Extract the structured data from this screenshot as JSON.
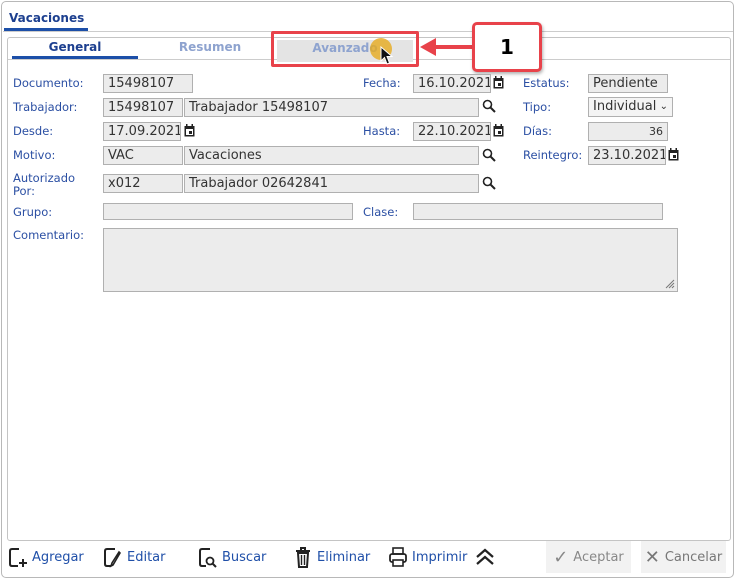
{
  "window": {
    "tab": "Vacaciones"
  },
  "tabs": [
    {
      "label": "General",
      "active": true
    },
    {
      "label": "Resumen"
    },
    {
      "label": "Avanzado"
    }
  ],
  "callout": {
    "number": "1"
  },
  "fields": {
    "documento": {
      "label": "Documento:",
      "value": "15498107"
    },
    "fecha": {
      "label": "Fecha:",
      "value": "16.10.2021"
    },
    "estatus": {
      "label": "Estatus:",
      "value": "Pendiente"
    },
    "trabajador": {
      "label": "Trabajador:",
      "code": "15498107",
      "name": "Trabajador 15498107"
    },
    "tipo": {
      "label": "Tipo:",
      "value": "Individual"
    },
    "desde": {
      "label": "Desde:",
      "value": "17.09.2021"
    },
    "hasta": {
      "label": "Hasta:",
      "value": "22.10.2021"
    },
    "dias": {
      "label": "Días:",
      "value": "36"
    },
    "motivo": {
      "label": "Motivo:",
      "code": "VAC",
      "name": "Vacaciones"
    },
    "reintegro": {
      "label": "Reintegro:",
      "value": "23.10.2021"
    },
    "autorizado": {
      "label1": "Autorizado",
      "label2": "Por:",
      "code": "x012",
      "name": "Trabajador 02642841"
    },
    "grupo": {
      "label": "Grupo:",
      "value": ""
    },
    "clase": {
      "label": "Clase:",
      "value": ""
    },
    "comentario": {
      "label": "Comentario:",
      "value": ""
    }
  },
  "footer": {
    "agregar": "Agregar",
    "editar": "Editar",
    "buscar": "Buscar",
    "eliminar": "Eliminar",
    "imprimir": "Imprimir",
    "aceptar": "Aceptar",
    "cancelar": "Cancelar"
  }
}
